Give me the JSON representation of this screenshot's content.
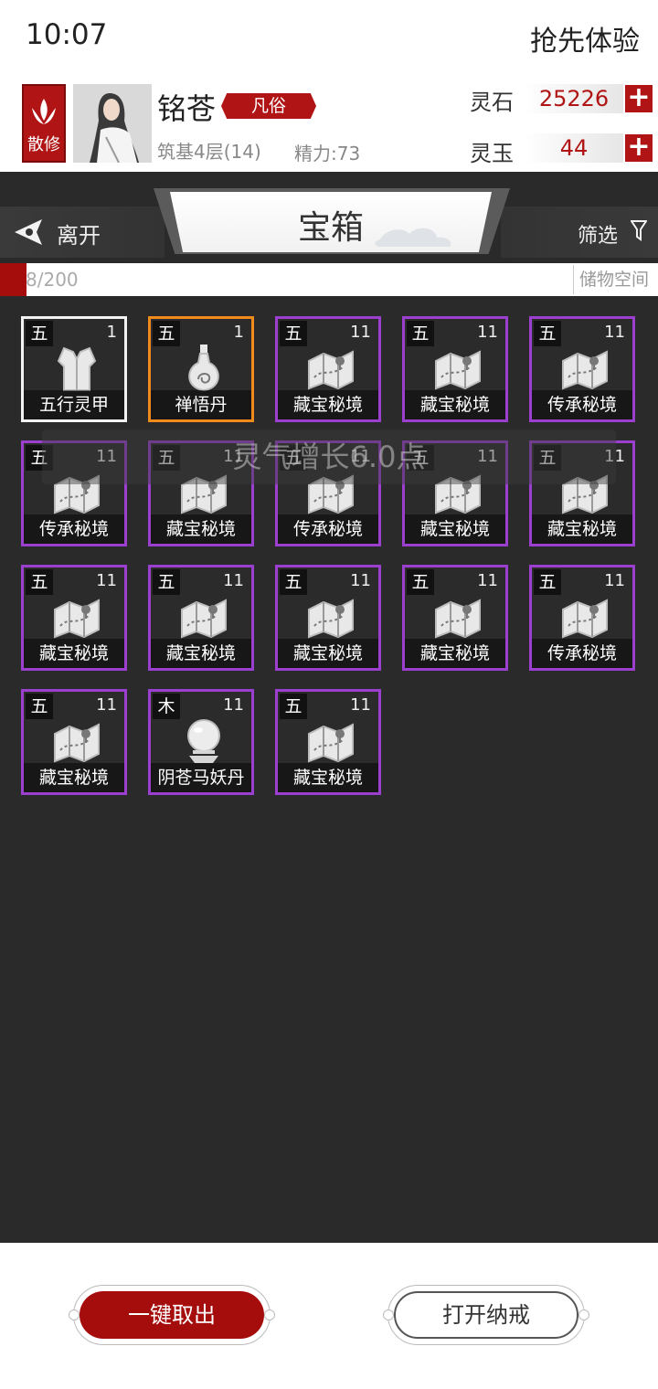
{
  "status_bar": {
    "time": "10:07",
    "promo": "抢先体验"
  },
  "profile": {
    "sect": "散修",
    "name": "铭苍",
    "rank": "凡俗",
    "realm": "筑基4层(14)",
    "energy": "精力:73",
    "currencies": [
      {
        "label": "灵石",
        "value": "25226"
      },
      {
        "label": "灵玉",
        "value": "44"
      }
    ]
  },
  "titlebar": {
    "back_label": "离开",
    "title": "宝箱",
    "filter_label": "筛选"
  },
  "capacity": {
    "text": "8/200",
    "tag": "储物空间",
    "fill_fraction": 0.04
  },
  "toast": "灵气增长6.0点",
  "items": [
    {
      "grade": "五",
      "count": "1",
      "name": "五行灵甲",
      "rarity": "white",
      "icon": "armor-icon"
    },
    {
      "grade": "五",
      "count": "1",
      "name": "禅悟丹",
      "rarity": "orange",
      "icon": "gourd-icon"
    },
    {
      "grade": "五",
      "count": "11",
      "name": "藏宝秘境",
      "rarity": "purple",
      "icon": "map-scroll-icon"
    },
    {
      "grade": "五",
      "count": "11",
      "name": "藏宝秘境",
      "rarity": "purple",
      "icon": "map-scroll-icon"
    },
    {
      "grade": "五",
      "count": "11",
      "name": "传承秘境",
      "rarity": "purple",
      "icon": "map-scroll-icon"
    },
    {
      "grade": "五",
      "count": "11",
      "name": "传承秘境",
      "rarity": "purple",
      "icon": "map-scroll-icon"
    },
    {
      "grade": "五",
      "count": "11",
      "name": "藏宝秘境",
      "rarity": "purple",
      "icon": "map-scroll-icon"
    },
    {
      "grade": "五",
      "count": "11",
      "name": "传承秘境",
      "rarity": "purple",
      "icon": "map-scroll-icon"
    },
    {
      "grade": "五",
      "count": "11",
      "name": "藏宝秘境",
      "rarity": "purple",
      "icon": "map-scroll-icon"
    },
    {
      "grade": "五",
      "count": "11",
      "name": "藏宝秘境",
      "rarity": "purple",
      "icon": "map-scroll-icon"
    },
    {
      "grade": "五",
      "count": "11",
      "name": "藏宝秘境",
      "rarity": "purple",
      "icon": "map-scroll-icon"
    },
    {
      "grade": "五",
      "count": "11",
      "name": "藏宝秘境",
      "rarity": "purple",
      "icon": "map-scroll-icon"
    },
    {
      "grade": "五",
      "count": "11",
      "name": "藏宝秘境",
      "rarity": "purple",
      "icon": "map-scroll-icon"
    },
    {
      "grade": "五",
      "count": "11",
      "name": "藏宝秘境",
      "rarity": "purple",
      "icon": "map-scroll-icon"
    },
    {
      "grade": "五",
      "count": "11",
      "name": "传承秘境",
      "rarity": "purple",
      "icon": "map-scroll-icon"
    },
    {
      "grade": "五",
      "count": "11",
      "name": "藏宝秘境",
      "rarity": "purple",
      "icon": "map-scroll-icon"
    },
    {
      "grade": "木",
      "count": "11",
      "name": "阴苍马妖丹",
      "rarity": "purple",
      "icon": "pearl-icon"
    },
    {
      "grade": "五",
      "count": "11",
      "name": "藏宝秘境",
      "rarity": "purple",
      "icon": "map-scroll-icon"
    }
  ],
  "actions": {
    "take_all": "一键取出",
    "open_ring": "打开纳戒"
  },
  "colors": {
    "accent_red": "#a50d0d",
    "purple": "#9b3fcf",
    "orange": "#f08a1a",
    "panel": "#2a2a2a"
  }
}
